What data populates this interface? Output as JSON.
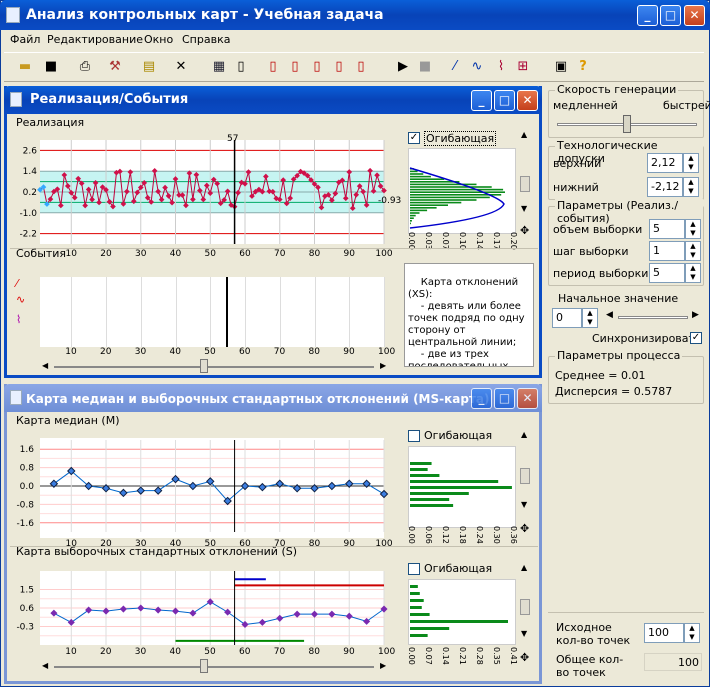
{
  "app": {
    "title": "Анализ контрольных карт - Учебная задача"
  },
  "menu": [
    "Файл",
    "Редактирование",
    "Окно",
    "Справка"
  ],
  "toolbar": {
    "icons": [
      "open-folder-icon",
      "save-icon",
      "print-icon",
      "settings-icon",
      "new-window-icon",
      "close-x-icon",
      "table-icon",
      "doc-icon",
      "doc2-icon",
      "doc3-icon",
      "doc4-icon",
      "doc5-icon",
      "doc6-icon",
      "play-icon",
      "stop-icon",
      "line-icon",
      "wave-icon",
      "trend-icon",
      "chart-icon",
      "camera-icon",
      "help-icon"
    ]
  },
  "win1": {
    "title": "Реализация/События",
    "realization_label": "Реализация",
    "events_label": "События",
    "cursor_label": "57",
    "last_value": "-0.93",
    "envelope_label": "Огибающая",
    "envelope_checked": true,
    "yticks": [
      "2.6",
      "1.4",
      "0.2",
      "-1.0",
      "-2.2"
    ],
    "xticks": [
      "10",
      "20",
      "30",
      "40",
      "50",
      "60",
      "70",
      "80",
      "90",
      "100"
    ],
    "hist_ticks": [
      "0.00",
      "0.03",
      "0.07",
      "0.10",
      "0.14",
      "0.17",
      "0.20"
    ],
    "message": "Карта отклонений (XS):\n    - девять или более точек подряд по одну сторону от центральной линии;\n    - две из трех последовательных точек в зоне А или вне",
    "chart_data": {
      "type": "line",
      "x_range": [
        1,
        100
      ],
      "ylim": [
        -2.8,
        3.2
      ],
      "cursor_x": 57
    }
  },
  "win2": {
    "title": "Карта медиан и выборочных стандартных отклонений (MS-карта)",
    "median_label": "Карта медиан (M)",
    "std_label": "Карта выборочных стандартных отклонений (S)",
    "envelope_label": "Огибающая",
    "envelope2_label": "Огибающая",
    "m_yticks": [
      "1.6",
      "0.8",
      "0.0",
      "-0.8",
      "-1.6"
    ],
    "s_yticks": [
      "1.5",
      "0.6",
      "-0.3"
    ],
    "xticks": [
      "10",
      "20",
      "30",
      "40",
      "50",
      "60",
      "70",
      "80",
      "90",
      "100"
    ],
    "m_hist_ticks": [
      "0.00",
      "0.06",
      "0.12",
      "0.18",
      "0.24",
      "0.30",
      "0.36"
    ],
    "s_hist_ticks": [
      "0.00",
      "0.07",
      "0.14",
      "0.21",
      "0.28",
      "0.35",
      "0.41"
    ],
    "chart_data": [
      {
        "type": "line",
        "title": "Карта медиан (M)",
        "x": [
          5,
          10,
          15,
          20,
          25,
          30,
          35,
          40,
          45,
          50,
          55,
          60,
          65,
          70,
          75,
          80,
          85,
          90,
          95,
          100
        ],
        "y": [
          0.1,
          0.65,
          0.0,
          -0.1,
          -0.3,
          -0.2,
          -0.2,
          0.3,
          0.0,
          0.2,
          -0.65,
          0.0,
          -0.05,
          0.1,
          -0.1,
          -0.1,
          0.0,
          0.1,
          0.1,
          -0.35
        ],
        "ylim": [
          -2.0,
          2.0
        ]
      },
      {
        "type": "line",
        "title": "Карта выборочных стандартных отклонений (S)",
        "x": [
          5,
          10,
          15,
          20,
          25,
          30,
          35,
          40,
          45,
          50,
          55,
          60,
          65,
          70,
          75,
          80,
          85,
          90,
          95,
          100
        ],
        "y": [
          0.35,
          -0.1,
          0.5,
          0.45,
          0.55,
          0.6,
          0.5,
          0.45,
          0.35,
          0.9,
          0.4,
          -0.2,
          -0.1,
          0.1,
          0.3,
          0.3,
          0.3,
          0.2,
          -0.05,
          0.55
        ],
        "ylim": [
          -1.2,
          2.4
        ]
      }
    ]
  },
  "right": {
    "speed_label": "Скорость генерации",
    "slow": "медленней",
    "fast": "быстрей",
    "tol_label": "Технологические допуски",
    "upper_label": "верхний",
    "upper_val": "2,12",
    "lower_label": "нижний",
    "lower_val": "-2,12",
    "params_label": "Параметры (Реализ./события)",
    "size_label": "объем выборки",
    "size_val": "5",
    "step_label": "шаг выборки",
    "step_val": "1",
    "period_label": "период  выборки",
    "period_val": "5",
    "init_label": "Начальное значение",
    "init_val": "0",
    "sync_label": "Синхронизировать",
    "proc_label": "Параметры процесса",
    "mean": "Среднее = 0.01",
    "var": "Дисперсия = 0.5787",
    "initial_count_label": "Исходное кол-во точек",
    "initial_count_val": "100",
    "total_label": "Общее кол-во точек",
    "total_val": "100"
  }
}
